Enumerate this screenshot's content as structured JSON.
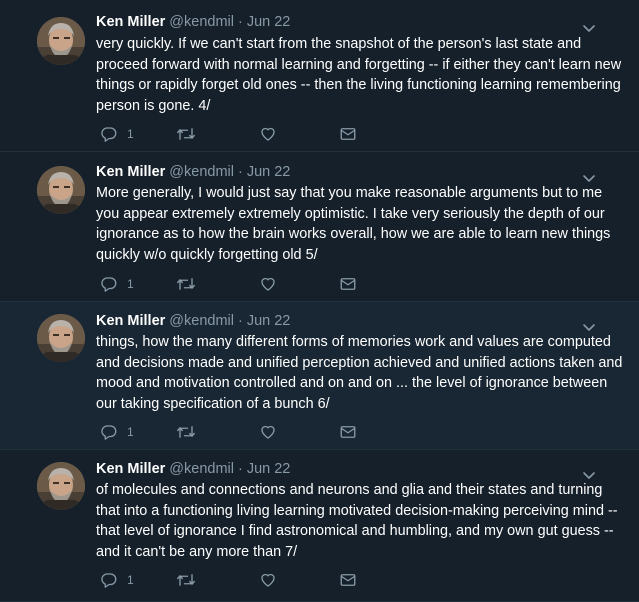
{
  "tweets": [
    {
      "author_name": "Ken Miller",
      "handle": "@kendmil",
      "separator": "·",
      "date": "Jun 22",
      "text": "very quickly. If we can't start from the snapshot of the person's last state and proceed forward with normal learning and forgetting -- if either they can't learn new things or rapidly forget old ones -- then the living functioning learning remembering person is gone. 4/",
      "reply_count": "1"
    },
    {
      "author_name": "Ken Miller",
      "handle": "@kendmil",
      "separator": "·",
      "date": "Jun 22",
      "text": "More generally, I would just say that you make reasonable arguments but to me you appear extremely extremely optimistic. I take very seriously the depth of our ignorance as to how the brain works overall, how we are able to learn new things quickly w/o quickly forgetting old 5/",
      "reply_count": "1"
    },
    {
      "author_name": "Ken Miller",
      "handle": "@kendmil",
      "separator": "·",
      "date": "Jun 22",
      "text": "things, how the many different forms of memories work and values are computed and decisions made and unified perception achieved and unified actions taken and mood and motivation controlled and on and on ... the level of ignorance between our taking specification of a bunch 6/",
      "reply_count": "1"
    },
    {
      "author_name": "Ken Miller",
      "handle": "@kendmil",
      "separator": "·",
      "date": "Jun 22",
      "text": "of molecules and connections and neurons and glia and their states and turning that into a functioning living learning motivated decision-making perceiving mind -- that level of ignorance I find astronomical and humbling, and my own gut guess -- and it can't be any more than 7/",
      "reply_count": "1"
    }
  ],
  "icons": {
    "reply": "reply-icon",
    "retweet": "retweet-icon",
    "like": "heart-icon",
    "dm": "envelope-icon",
    "menu": "chevron-down-icon"
  },
  "colors": {
    "background": "#15202b",
    "background_alt": "#192734",
    "thread_line": "#1d9bf0",
    "secondary_text": "#8899a6"
  }
}
